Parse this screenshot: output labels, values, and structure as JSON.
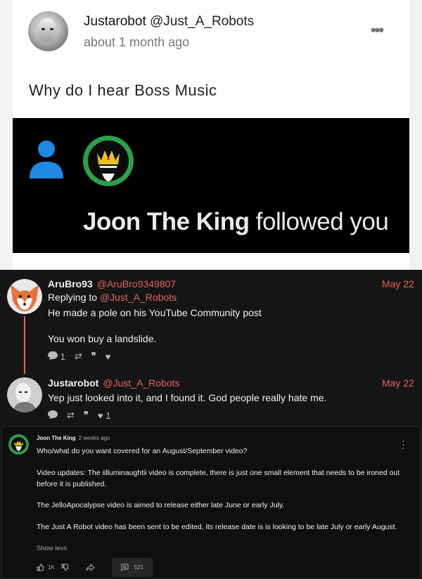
{
  "post": {
    "display_name": "Justarobot",
    "handle": "@Just_A_Robots",
    "time": "about 1 month ago",
    "more_icon": "•••",
    "text": "Why do I hear Boss Music",
    "media": {
      "name": "Joon The King",
      "action": "followed you"
    }
  },
  "tweets": [
    {
      "name": "AruBro93",
      "handle": "@AruBro9349807",
      "date": "May 22",
      "replying_prefix": "Replying to ",
      "replying_handle": "@Just_A_Robots",
      "line1": "He made a pole on his YouTube Community post",
      "line2": "You won buy a landslide.",
      "replies": "1",
      "likes": ""
    },
    {
      "name": "Justarobot",
      "handle": "@Just_A_Robots",
      "date": "May 22",
      "line1": "Yep just looked into it, and I found it. God people really hate me.",
      "replies": "",
      "likes": "1"
    }
  ],
  "yt_comment": {
    "author": "Joon The King",
    "time": "2 weeks ago",
    "p1": "Who/what do you want covered for an August/September video?",
    "p2": "Video updates: The iilluminaughtii video is complete, there is just one small element that needs to be ironed out before it is published.",
    "p3": "The JelloApocalypse video is aimed to release either late June or early July.",
    "p4": "The Just A Robot video has been sent to be edited, its release date is is looking to be late July or early August.",
    "show_less": "Show less",
    "likes": "1K",
    "comments": "521"
  },
  "colors": {
    "accent": "#e0655a",
    "badge_green": "#2aa04a",
    "person_blue": "#1e88e5"
  }
}
